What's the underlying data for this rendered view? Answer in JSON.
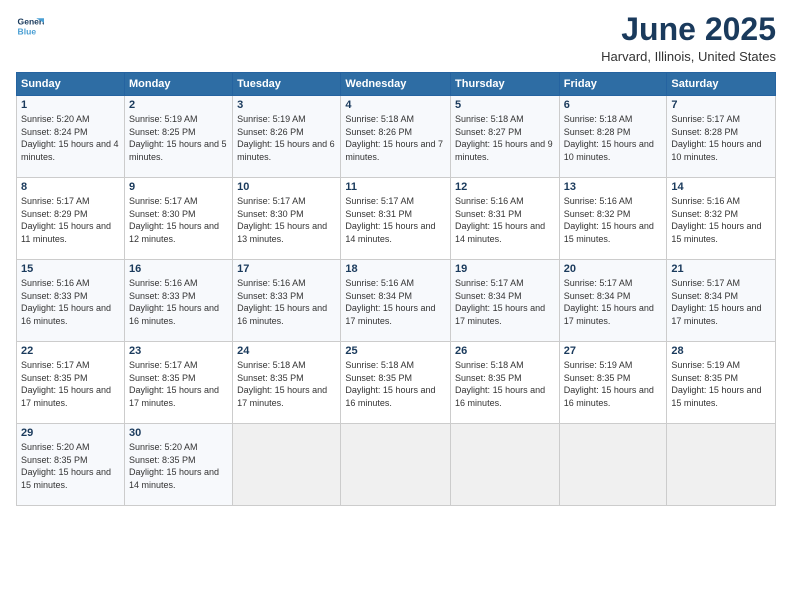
{
  "header": {
    "logo_line1": "General",
    "logo_line2": "Blue",
    "month": "June 2025",
    "location": "Harvard, Illinois, United States"
  },
  "weekdays": [
    "Sunday",
    "Monday",
    "Tuesday",
    "Wednesday",
    "Thursday",
    "Friday",
    "Saturday"
  ],
  "weeks": [
    [
      {
        "day": 1,
        "sunrise": "5:20 AM",
        "sunset": "8:24 PM",
        "daylight": "15 hours and 4 minutes."
      },
      {
        "day": 2,
        "sunrise": "5:19 AM",
        "sunset": "8:25 PM",
        "daylight": "15 hours and 5 minutes."
      },
      {
        "day": 3,
        "sunrise": "5:19 AM",
        "sunset": "8:26 PM",
        "daylight": "15 hours and 6 minutes."
      },
      {
        "day": 4,
        "sunrise": "5:18 AM",
        "sunset": "8:26 PM",
        "daylight": "15 hours and 7 minutes."
      },
      {
        "day": 5,
        "sunrise": "5:18 AM",
        "sunset": "8:27 PM",
        "daylight": "15 hours and 9 minutes."
      },
      {
        "day": 6,
        "sunrise": "5:18 AM",
        "sunset": "8:28 PM",
        "daylight": "15 hours and 10 minutes."
      },
      {
        "day": 7,
        "sunrise": "5:17 AM",
        "sunset": "8:28 PM",
        "daylight": "15 hours and 10 minutes."
      }
    ],
    [
      {
        "day": 8,
        "sunrise": "5:17 AM",
        "sunset": "8:29 PM",
        "daylight": "15 hours and 11 minutes."
      },
      {
        "day": 9,
        "sunrise": "5:17 AM",
        "sunset": "8:30 PM",
        "daylight": "15 hours and 12 minutes."
      },
      {
        "day": 10,
        "sunrise": "5:17 AM",
        "sunset": "8:30 PM",
        "daylight": "15 hours and 13 minutes."
      },
      {
        "day": 11,
        "sunrise": "5:17 AM",
        "sunset": "8:31 PM",
        "daylight": "15 hours and 14 minutes."
      },
      {
        "day": 12,
        "sunrise": "5:16 AM",
        "sunset": "8:31 PM",
        "daylight": "15 hours and 14 minutes."
      },
      {
        "day": 13,
        "sunrise": "5:16 AM",
        "sunset": "8:32 PM",
        "daylight": "15 hours and 15 minutes."
      },
      {
        "day": 14,
        "sunrise": "5:16 AM",
        "sunset": "8:32 PM",
        "daylight": "15 hours and 15 minutes."
      }
    ],
    [
      {
        "day": 15,
        "sunrise": "5:16 AM",
        "sunset": "8:33 PM",
        "daylight": "15 hours and 16 minutes."
      },
      {
        "day": 16,
        "sunrise": "5:16 AM",
        "sunset": "8:33 PM",
        "daylight": "15 hours and 16 minutes."
      },
      {
        "day": 17,
        "sunrise": "5:16 AM",
        "sunset": "8:33 PM",
        "daylight": "15 hours and 16 minutes."
      },
      {
        "day": 18,
        "sunrise": "5:16 AM",
        "sunset": "8:34 PM",
        "daylight": "15 hours and 17 minutes."
      },
      {
        "day": 19,
        "sunrise": "5:17 AM",
        "sunset": "8:34 PM",
        "daylight": "15 hours and 17 minutes."
      },
      {
        "day": 20,
        "sunrise": "5:17 AM",
        "sunset": "8:34 PM",
        "daylight": "15 hours and 17 minutes."
      },
      {
        "day": 21,
        "sunrise": "5:17 AM",
        "sunset": "8:34 PM",
        "daylight": "15 hours and 17 minutes."
      }
    ],
    [
      {
        "day": 22,
        "sunrise": "5:17 AM",
        "sunset": "8:35 PM",
        "daylight": "15 hours and 17 minutes."
      },
      {
        "day": 23,
        "sunrise": "5:17 AM",
        "sunset": "8:35 PM",
        "daylight": "15 hours and 17 minutes."
      },
      {
        "day": 24,
        "sunrise": "5:18 AM",
        "sunset": "8:35 PM",
        "daylight": "15 hours and 17 minutes."
      },
      {
        "day": 25,
        "sunrise": "5:18 AM",
        "sunset": "8:35 PM",
        "daylight": "15 hours and 16 minutes."
      },
      {
        "day": 26,
        "sunrise": "5:18 AM",
        "sunset": "8:35 PM",
        "daylight": "15 hours and 16 minutes."
      },
      {
        "day": 27,
        "sunrise": "5:19 AM",
        "sunset": "8:35 PM",
        "daylight": "15 hours and 16 minutes."
      },
      {
        "day": 28,
        "sunrise": "5:19 AM",
        "sunset": "8:35 PM",
        "daylight": "15 hours and 15 minutes."
      }
    ],
    [
      {
        "day": 29,
        "sunrise": "5:20 AM",
        "sunset": "8:35 PM",
        "daylight": "15 hours and 15 minutes."
      },
      {
        "day": 30,
        "sunrise": "5:20 AM",
        "sunset": "8:35 PM",
        "daylight": "15 hours and 14 minutes."
      },
      null,
      null,
      null,
      null,
      null
    ]
  ]
}
